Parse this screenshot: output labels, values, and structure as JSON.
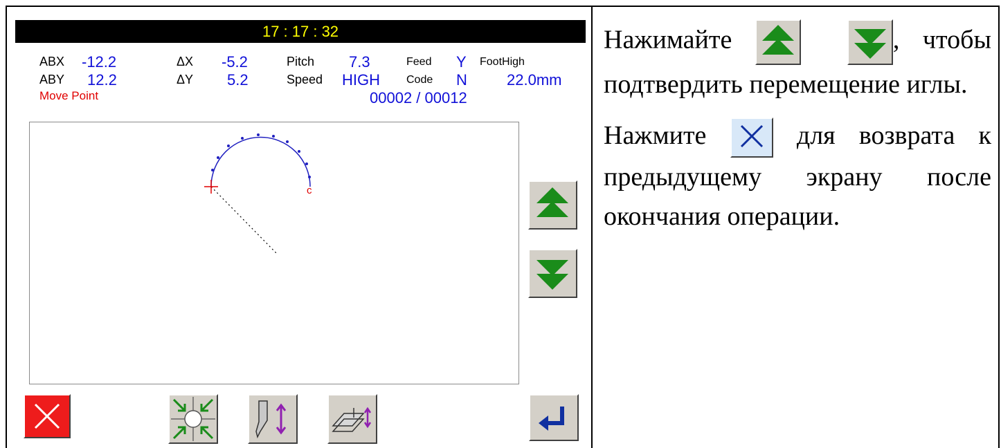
{
  "screen": {
    "clock": "17 : 17 : 32",
    "info": {
      "abx_label": "ABX",
      "abx_value": "-12.2",
      "aby_label": "ABY",
      "aby_value": "12.2",
      "dx_label": "ΔX",
      "dx_value": "-5.2",
      "dy_label": "ΔY",
      "dy_value": "5.2",
      "pitch_label": "Pitch",
      "pitch_value": "7.3",
      "speed_label": "Speed",
      "speed_value": "HIGH",
      "feed_label": "Feed",
      "feed_value": "Y",
      "code_label": "Code",
      "code_value": "N",
      "foothigh_label": "FootHigh",
      "foothigh_value": "22.0mm",
      "mode": "Move Point",
      "counter": "00002  /  00012"
    },
    "canvas": {
      "end_marker": "c"
    },
    "buttons": {
      "up": "arrow-up-green-icon",
      "down": "arrow-down-green-icon",
      "cancel": "close-red-icon",
      "center": "center-point-icon",
      "needle": "needle-up-down-icon",
      "foot": "presser-foot-height-icon",
      "enter": "enter-return-icon"
    },
    "colors": {
      "title_bg": "#000000",
      "clock": "#ffff00",
      "value": "#1010d8",
      "mode": "#e00000",
      "arrow": "#1a8c1a",
      "cancel_bg": "#ee1c1c"
    }
  },
  "instructions": {
    "p1_before": "Нажимайте ",
    "p1_after": ", чтобы подтвердить перемещение иглы.",
    "p2_before": "Нажмите ",
    "p2_after": " для возврата к предыдущему экрану после окончания операции."
  }
}
